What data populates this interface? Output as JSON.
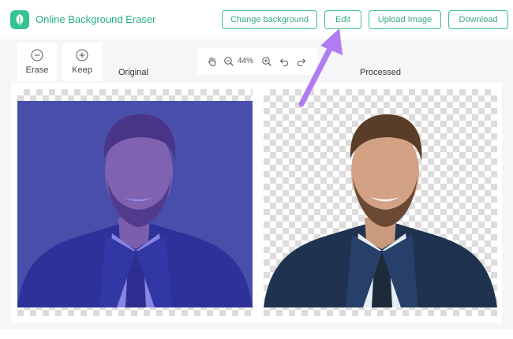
{
  "app": {
    "title": "Online Background Eraser",
    "brand_color": "#35c48f",
    "logo_icon": "leaf-icon"
  },
  "toolbar": {
    "change_background": "Change background",
    "edit": "Edit",
    "upload_image": "Upload Image",
    "download": "Download"
  },
  "tools": {
    "erase": {
      "label": "Erase",
      "icon": "minus-circle-icon"
    },
    "keep": {
      "label": "Keep",
      "icon": "plus-circle-icon"
    }
  },
  "zoom": {
    "level": "44%",
    "icons": [
      "hand-icon",
      "zoom-out-icon",
      "zoom-in-icon",
      "undo-icon",
      "redo-icon"
    ]
  },
  "panels": {
    "original_label": "Original",
    "processed_label": "Processed"
  },
  "overlay": {
    "highlight_color": "#3a2fd6",
    "arrow_color": "#b07cf0",
    "arrow_target": "Edit"
  }
}
